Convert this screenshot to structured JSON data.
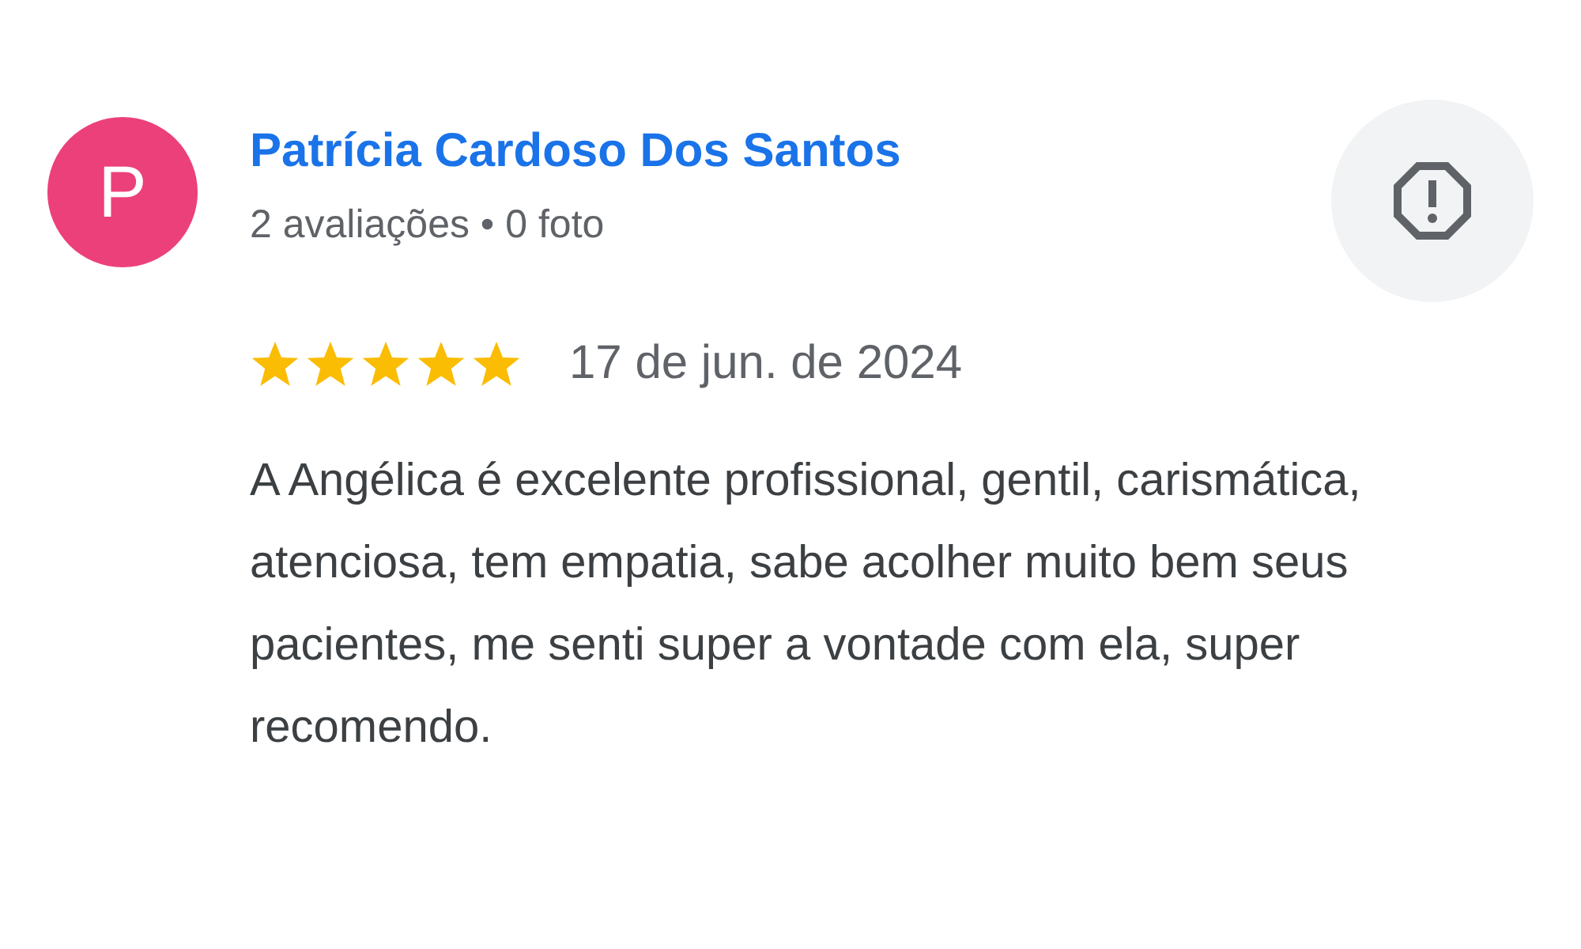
{
  "review": {
    "avatar_letter": "P",
    "author": "Patrícia Cardoso Dos Santos",
    "meta": "2 avaliações • 0 foto",
    "stars": 5,
    "date": "17 de jun. de 2024",
    "text": "A Angélica é excelente profissional, gentil, carismática, atenciosa, tem empatia, sabe acolher muito bem seus pacientes, me senti super a vontade com ela, super recomendo."
  }
}
